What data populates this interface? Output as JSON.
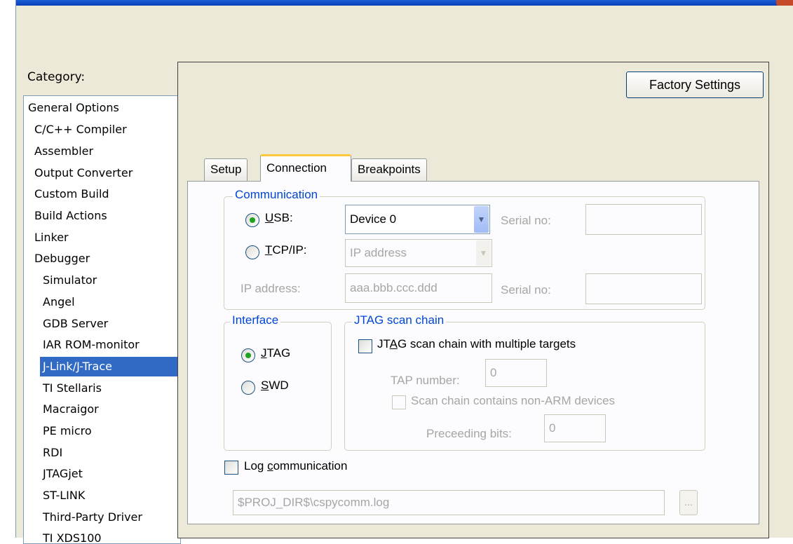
{
  "category": {
    "label": "Category:",
    "items": [
      {
        "label": "General Options"
      },
      {
        "label": "C/C++ Compiler"
      },
      {
        "label": "Assembler"
      },
      {
        "label": "Output Converter"
      },
      {
        "label": "Custom Build"
      },
      {
        "label": "Build Actions"
      },
      {
        "label": "Linker"
      },
      {
        "label": "Debugger"
      },
      {
        "label": "Simulator"
      },
      {
        "label": "Angel"
      },
      {
        "label": "GDB Server"
      },
      {
        "label": "IAR ROM-monitor"
      },
      {
        "label": "J-Link/J-Trace",
        "selected": true
      },
      {
        "label": "TI Stellaris"
      },
      {
        "label": "Macraigor"
      },
      {
        "label": "PE micro"
      },
      {
        "label": "RDI"
      },
      {
        "label": "JTAGjet"
      },
      {
        "label": "ST-LINK"
      },
      {
        "label": "Third-Party Driver"
      },
      {
        "label": "TI XDS100"
      }
    ]
  },
  "factory_settings_label": "Factory Settings",
  "tabs": [
    {
      "label": "Setup"
    },
    {
      "label": "Connection",
      "active": true
    },
    {
      "label": "Breakpoints"
    }
  ],
  "communication": {
    "legend": "Communication",
    "usb": {
      "prefix": "",
      "underline": "U",
      "suffix": "SB:",
      "checked": true
    },
    "device_value": "Device 0",
    "serial_label_1": "Serial no:",
    "serial_value_1": "",
    "tcpip": {
      "prefix": "",
      "underline": "T",
      "suffix": "CP/IP:",
      "checked": false
    },
    "ip_combo_value": "IP address",
    "ip_address_label": "IP address:",
    "ip_address_value": "aaa.bbb.ccc.ddd",
    "serial_label_2": "Serial no:",
    "serial_value_2": ""
  },
  "interface": {
    "legend": "Interface",
    "jtag": {
      "prefix": "",
      "underline": "J",
      "suffix": "TAG",
      "checked": true
    },
    "swd": {
      "prefix": "",
      "underline": "S",
      "suffix": "WD",
      "checked": false
    }
  },
  "jtag_chain": {
    "legend": "JTAG scan chain",
    "multi_targets": {
      "prefix": "JT",
      "underline": "A",
      "suffix": "G scan chain with multiple targets",
      "checked": false
    },
    "tap_label": "TAP number:",
    "tap_value": "0",
    "non_arm_label": "Scan chain contains non-ARM devices",
    "preceeding_label": "Preceeding bits:",
    "preceeding_value": "0"
  },
  "log": {
    "prefix": "Log ",
    "underline": "c",
    "suffix": "ommunication",
    "checked": false,
    "path_value": "$PROJ_DIR$\\cspycomm.log",
    "browse_label": "..."
  },
  "colors": {
    "selection": "#316ac5",
    "legend_text": "#0046d5",
    "active_tab_accent": "#ffc83c",
    "dialog_bg": "#ece9d8"
  }
}
